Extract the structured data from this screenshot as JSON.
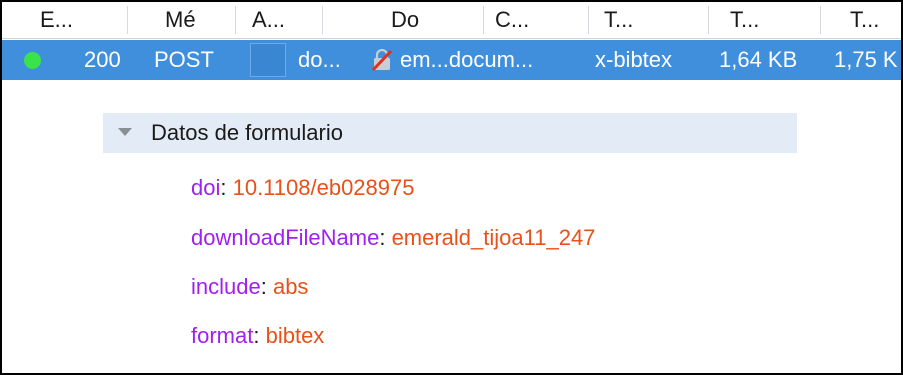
{
  "columns": [
    "E...",
    "Mé",
    "A...",
    "Do",
    "C...",
    "T...",
    "T...",
    "T..."
  ],
  "request": {
    "status": "200",
    "method": "POST",
    "file": "do...",
    "domain": "em...docum...",
    "type": "x-bibtex",
    "transferred": "1,64 KB",
    "size": "1,75 K",
    "status_color": "#3be34a",
    "row_color": "#3f8fdc"
  },
  "form_data": {
    "title": "Datos de formulario",
    "params": [
      {
        "key": "doi",
        "value": "10.1108/eb028975"
      },
      {
        "key": "downloadFileName",
        "value": "emerald_tijoa11_247"
      },
      {
        "key": "include",
        "value": "abs"
      },
      {
        "key": "format",
        "value": "bibtex"
      }
    ]
  },
  "colors": {
    "param_key": "#a020f0",
    "param_value": "#e8511a",
    "section_bg": "#e3ecf6"
  }
}
